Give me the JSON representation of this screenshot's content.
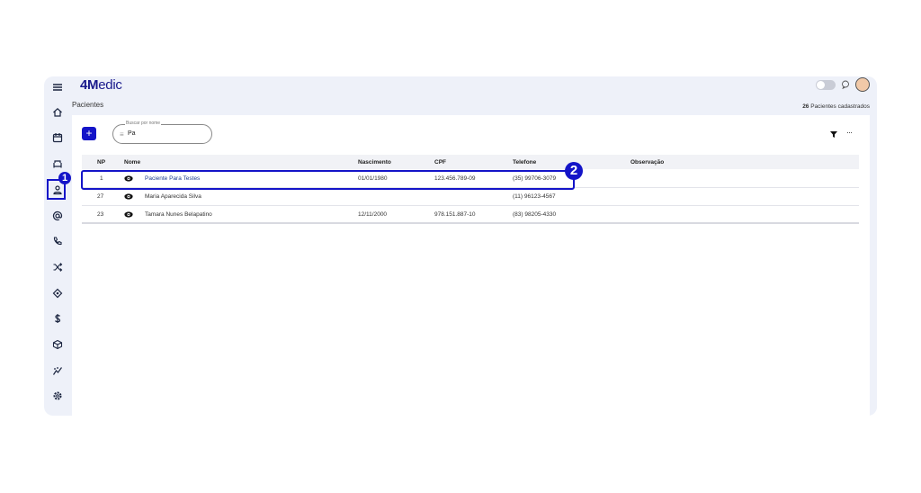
{
  "brand": {
    "name_bold": "4M",
    "name_rest": "edic"
  },
  "page": {
    "title": "Pacientes",
    "count_number": "26",
    "count_label": "Pacientes cadastrados"
  },
  "toolbar": {
    "add_label": "+",
    "more_label": "···"
  },
  "search": {
    "legend": "Buscar por nome",
    "value": "Pa"
  },
  "table": {
    "headers": {
      "np": "NP",
      "nome": "Nome",
      "nascimento": "Nascimento",
      "cpf": "CPF",
      "telefone": "Telefone",
      "observacao": "Observação"
    },
    "rows": [
      {
        "np": "1",
        "nome": "Paciente Para Testes",
        "nascimento": "01/01/1980",
        "cpf": "123.456.789-09",
        "telefone": "(35) 99706-3079",
        "observacao": ""
      },
      {
        "np": "27",
        "nome": "Maria Aparecida Silva",
        "nascimento": "",
        "cpf": "",
        "telefone": "(11) 96123-4567",
        "observacao": ""
      },
      {
        "np": "23",
        "nome": "Tamara Nunes Belapatino",
        "nascimento": "12/11/2000",
        "cpf": "978.151.887-10",
        "telefone": "(83) 98205-4330",
        "observacao": ""
      }
    ]
  },
  "annotations": {
    "step1": "1",
    "step2": "2"
  },
  "sidebar": {
    "items": [
      {
        "icon": "menu-icon"
      },
      {
        "icon": "home-icon"
      },
      {
        "icon": "calendar-icon"
      },
      {
        "icon": "waiting-room-icon"
      },
      {
        "icon": "patients-icon"
      },
      {
        "icon": "at-icon"
      },
      {
        "icon": "phone-icon"
      },
      {
        "icon": "shuffle-icon"
      },
      {
        "icon": "tag-icon"
      },
      {
        "icon": "dollar-icon"
      },
      {
        "icon": "box-icon"
      },
      {
        "icon": "chart-icon"
      },
      {
        "icon": "settings-icon"
      }
    ]
  },
  "colors": {
    "accent": "#1414c8",
    "background": "#eef1f9",
    "link": "#1a3a8f"
  }
}
